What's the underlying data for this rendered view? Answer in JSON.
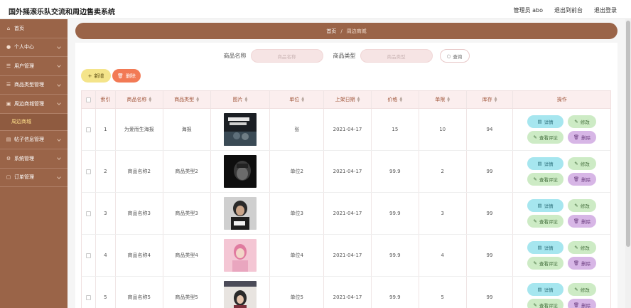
{
  "app": {
    "title": "国外摇滚乐队交流和周边售卖系统",
    "admin_label": "管理员 abo",
    "back_label": "退出到前台",
    "logout_label": "退出登录"
  },
  "sidebar": {
    "items": [
      {
        "label": "首页",
        "icon": "home-icon",
        "has_children": false
      },
      {
        "label": "个人中心",
        "icon": "user-icon",
        "has_children": true
      },
      {
        "label": "用户管理",
        "icon": "list-icon",
        "has_children": true
      },
      {
        "label": "商品类型管理",
        "icon": "list-icon",
        "has_children": true
      },
      {
        "label": "周边商城管理",
        "icon": "shop-icon",
        "has_children": true
      },
      {
        "label": "周边商城",
        "sub": true
      },
      {
        "label": "帖子信息管理",
        "icon": "book-icon",
        "has_children": true
      },
      {
        "label": "系统管理",
        "icon": "gear-icon",
        "has_children": true
      },
      {
        "label": "订单管理",
        "icon": "file-icon",
        "has_children": true
      }
    ]
  },
  "breadcrumb": {
    "home": "首页",
    "separator": "/",
    "current": "周边商城"
  },
  "search": {
    "name_label": "商品名称",
    "name_placeholder": "商品名称",
    "type_label": "商品类型",
    "type_placeholder": "商品类型",
    "query_label": "查询"
  },
  "toolbar": {
    "add_label": "新增",
    "delete_label": "删除"
  },
  "table": {
    "headers": [
      "索引",
      "商品名称",
      "商品类型",
      "图片",
      "单位",
      "上架日期",
      "价格",
      "单限",
      "库存",
      "操作"
    ],
    "rows": [
      {
        "index": "1",
        "name": "为爱而生海报",
        "type": "海报",
        "unit": "张",
        "date": "2021-04-17",
        "price": "15",
        "limit": "10",
        "stock": "94",
        "image": "album-1"
      },
      {
        "index": "2",
        "name": "商品名称2",
        "type": "商品类型2",
        "unit": "单位2",
        "date": "2021-04-17",
        "price": "99.9",
        "limit": "2",
        "stock": "99",
        "image": "album-2"
      },
      {
        "index": "3",
        "name": "商品名称3",
        "type": "商品类型3",
        "unit": "单位3",
        "date": "2021-04-17",
        "price": "99.9",
        "limit": "3",
        "stock": "99",
        "image": "album-3"
      },
      {
        "index": "4",
        "name": "商品名称4",
        "type": "商品类型4",
        "unit": "单位4",
        "date": "2021-04-17",
        "price": "99.9",
        "limit": "4",
        "stock": "99",
        "image": "album-4"
      },
      {
        "index": "5",
        "name": "商品名称5",
        "type": "商品类型5",
        "unit": "单位5",
        "date": "2021-04-17",
        "price": "99.9",
        "limit": "5",
        "stock": "99",
        "image": "album-5"
      }
    ],
    "ops": {
      "detail": "详情",
      "edit": "修改",
      "review": "查看评论",
      "remove": "删除"
    }
  },
  "colors": {
    "sidebar": "#9a6448",
    "accent_sub": "#ffe08a",
    "header_bg": "#fbeeee",
    "delete": "#f27a55",
    "add": "#f4e48a"
  }
}
